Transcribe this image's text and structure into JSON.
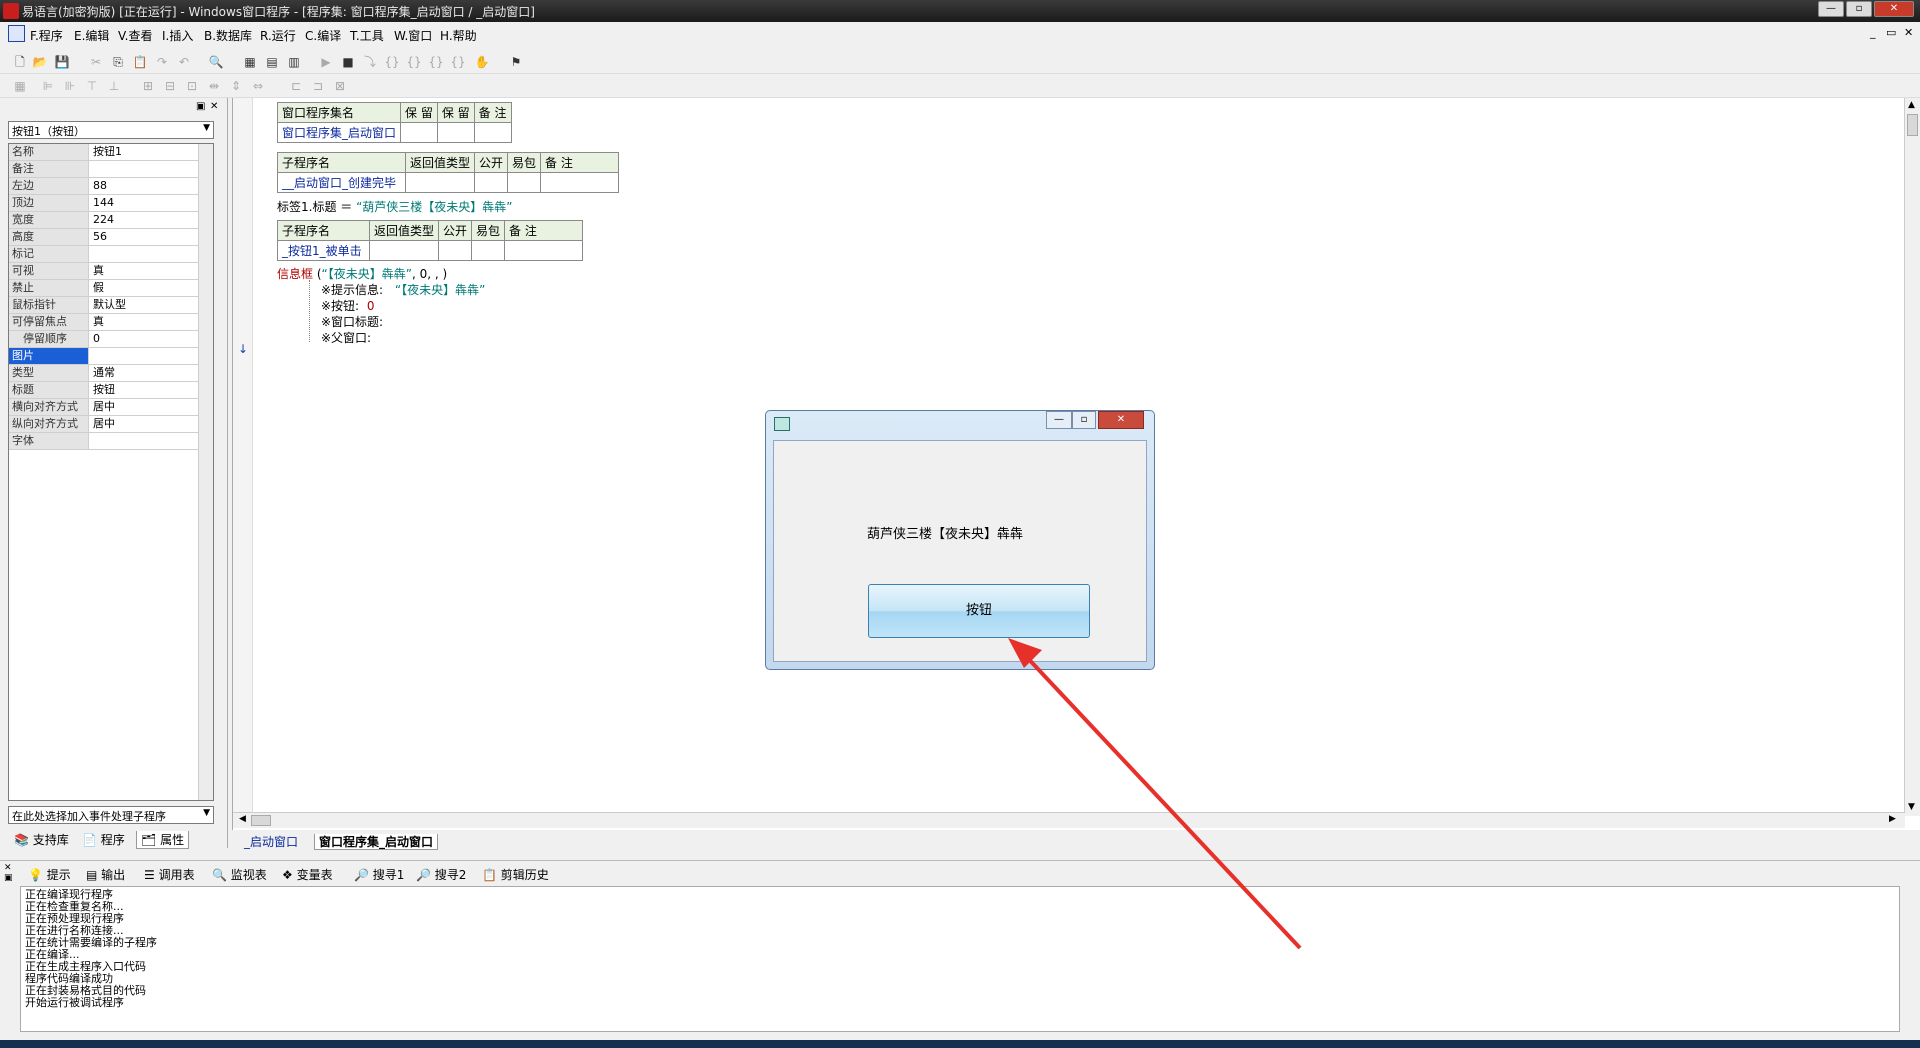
{
  "window": {
    "title": "易语言(加密狗版) [正在运行] - Windows窗口程序 - [程序集: 窗口程序集_启动窗口 / _启动窗口]"
  },
  "menu": [
    "F.程序",
    "E.编辑",
    "V.查看",
    "I.插入",
    "B.数据库",
    "R.运行",
    "C.编译",
    "T.工具",
    "W.窗口",
    "H.帮助"
  ],
  "left_panel": {
    "object_select": "按钮1（按钮）",
    "properties": [
      {
        "name": "名称",
        "value": "按钮1"
      },
      {
        "name": "备注",
        "value": ""
      },
      {
        "name": "左边",
        "value": "88"
      },
      {
        "name": "顶边",
        "value": "144"
      },
      {
        "name": "宽度",
        "value": "224"
      },
      {
        "name": "高度",
        "value": "56"
      },
      {
        "name": "标记",
        "value": ""
      },
      {
        "name": "可视",
        "value": "真"
      },
      {
        "name": "禁止",
        "value": "假"
      },
      {
        "name": "鼠标指针",
        "value": "默认型"
      },
      {
        "name": "可停留焦点",
        "value": "真"
      },
      {
        "name": "停留顺序",
        "value": "0"
      },
      {
        "name": "图片",
        "value": ""
      },
      {
        "name": "类型",
        "value": "通常"
      },
      {
        "name": "标题",
        "value": "按钮"
      },
      {
        "name": "横向对齐方式",
        "value": "居中"
      },
      {
        "name": "纵向对齐方式",
        "value": "居中"
      },
      {
        "name": "字体",
        "value": ""
      }
    ],
    "event_select": "在此处选择加入事件处理子程序",
    "tabs": [
      "支持库",
      "程序",
      "属性"
    ]
  },
  "code": {
    "assembly_table": {
      "headers": [
        "窗口程序集名",
        "保 留",
        "保 留",
        "备 注"
      ],
      "row": [
        "窗口程序集_启动窗口",
        "",
        "",
        ""
      ]
    },
    "sub1_table": {
      "headers": [
        "子程序名",
        "返回值类型",
        "公开",
        "易包",
        "备 注"
      ],
      "row": [
        "__启动窗口_创建完毕",
        "",
        "",
        "",
        ""
      ]
    },
    "line1_prefix": "标签1.标题 ＝ ",
    "line1_string": "“葫芦侠三楼【夜未央】犇犇”",
    "sub2_table": {
      "headers": [
        "子程序名",
        "返回值类型",
        "公开",
        "易包",
        "备 注"
      ],
      "row": [
        "_按钮1_被单击",
        "",
        "",
        "",
        ""
      ]
    },
    "msgbox_cmd": "信息框",
    "msgbox_open": " (",
    "msgbox_str": "“【夜未央】犇犇”",
    "msgbox_rest": ", 0, , )",
    "param1_label": "※提示信息: ",
    "param1_value": "“【夜未央】犇犇”",
    "param2_label": "※按钮: ",
    "param2_value": "0",
    "param3_label": "※窗口标题:",
    "param4_label": "※父窗口:",
    "tabs": [
      "_启动窗口",
      "窗口程序集_启动窗口"
    ]
  },
  "bottom_panel": {
    "tabs": [
      "提示",
      "输出",
      "调用表",
      "监视表",
      "变量表",
      "搜寻1",
      "搜寻2",
      "剪辑历史"
    ],
    "output_lines": [
      "正在编译现行程序",
      "正在检查重复名称...",
      "正在预处理现行程序",
      "正在进行名称连接...",
      "正在统计需要编译的子程序",
      "正在编译...",
      "正在生成主程序入口代码",
      "程序代码编译成功",
      "正在封装易格式目的代码",
      "开始运行被调试程序"
    ]
  },
  "app_window": {
    "label_text": "葫芦侠三楼【夜未央】犇犇",
    "button_text": "按钮"
  },
  "colors": {
    "annotation_arrow": "#e8302a",
    "selected_property": "#1a5fd6",
    "code_table_header": "#e9f2e1",
    "code_blue": "#0d2a9d",
    "code_green": "#007a76",
    "code_red": "#b00000"
  }
}
